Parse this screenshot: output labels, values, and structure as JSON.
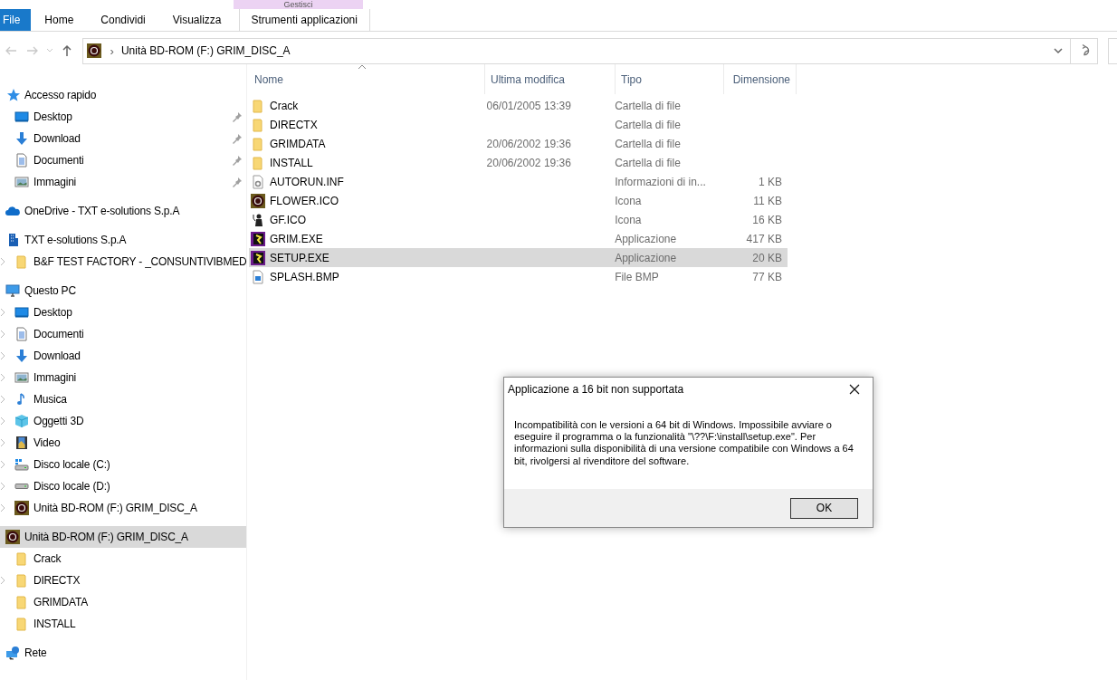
{
  "ribbon": {
    "context_header": "Gestisci",
    "tabs": [
      {
        "label": "File",
        "kind": "file"
      },
      {
        "label": "Home",
        "kind": "tab"
      },
      {
        "label": "Condividi",
        "kind": "tab"
      },
      {
        "label": "Visualizza",
        "kind": "tab"
      },
      {
        "label": "Strumenti applicazioni",
        "kind": "contextual"
      }
    ]
  },
  "address_bar": {
    "separator": "›",
    "path": "Unità BD-ROM (F:) GRIM_DISC_A"
  },
  "navigation": [
    {
      "label": "Accesso rapido",
      "kind": "star",
      "selected": false,
      "children": [
        {
          "label": "Desktop",
          "kind": "desktop",
          "pinned": true,
          "expandable": false
        },
        {
          "label": "Download",
          "kind": "download",
          "pinned": true,
          "expandable": false
        },
        {
          "label": "Documenti",
          "kind": "document",
          "pinned": true,
          "expandable": false
        },
        {
          "label": "Immagini",
          "kind": "image",
          "pinned": true,
          "expandable": false
        }
      ]
    },
    {
      "label": "OneDrive - TXT e-solutions S.p.A",
      "kind": "cloud",
      "selected": false
    },
    {
      "label": "TXT e-solutions S.p.A",
      "kind": "building",
      "selected": false,
      "children": [
        {
          "label": "B&F TEST FACTORY - _CONSUNTIVIBMED",
          "kind": "folder",
          "pinned": false,
          "expandable": true
        }
      ]
    },
    {
      "label": "Questo PC",
      "kind": "pc",
      "selected": false,
      "children": [
        {
          "label": "Desktop",
          "kind": "desktop",
          "pinned": false,
          "expandable": true
        },
        {
          "label": "Documenti",
          "kind": "document",
          "pinned": false,
          "expandable": true
        },
        {
          "label": "Download",
          "kind": "download",
          "pinned": false,
          "expandable": true
        },
        {
          "label": "Immagini",
          "kind": "image",
          "pinned": false,
          "expandable": true
        },
        {
          "label": "Musica",
          "kind": "music",
          "pinned": false,
          "expandable": true
        },
        {
          "label": "Oggetti 3D",
          "kind": "cube",
          "pinned": false,
          "expandable": true
        },
        {
          "label": "Video",
          "kind": "video",
          "pinned": false,
          "expandable": true
        },
        {
          "label": "Disco locale (C:)",
          "kind": "drive-c",
          "pinned": false,
          "expandable": true
        },
        {
          "label": "Disco locale (D:)",
          "kind": "drive",
          "pinned": false,
          "expandable": true
        },
        {
          "label": "Unità BD-ROM (F:) GRIM_DISC_A",
          "kind": "disc",
          "pinned": false,
          "expandable": true
        }
      ]
    },
    {
      "label": "Unità BD-ROM (F:) GRIM_DISC_A",
      "kind": "disc",
      "selected": true,
      "children": [
        {
          "label": "Crack",
          "kind": "folder",
          "pinned": false,
          "expandable": false
        },
        {
          "label": "DIRECTX",
          "kind": "folder",
          "pinned": false,
          "expandable": true
        },
        {
          "label": "GRIMDATA",
          "kind": "folder",
          "pinned": false,
          "expandable": false
        },
        {
          "label": "INSTALL",
          "kind": "folder",
          "pinned": false,
          "expandable": false
        }
      ]
    },
    {
      "label": "Rete",
      "kind": "network",
      "selected": false
    }
  ],
  "file_list": {
    "columns": [
      "Nome",
      "Ultima modifica",
      "Tipo",
      "Dimensione"
    ],
    "rows": [
      {
        "name": "Crack",
        "modified": "06/01/2005 13:39",
        "type": "Cartella di file",
        "kind": "folder",
        "selected": false
      },
      {
        "name": "DIRECTX",
        "type": "Cartella di file",
        "kind": "folder",
        "selected": false
      },
      {
        "name": "GRIMDATA",
        "modified": "20/06/2002 19:36",
        "type": "Cartella di file",
        "kind": "folder",
        "selected": false
      },
      {
        "name": "INSTALL",
        "modified": "20/06/2002 19:36",
        "type": "Cartella di file",
        "kind": "folder",
        "selected": false
      },
      {
        "name": "AUTORUN.INF",
        "type": "Informazioni di in...",
        "size": "1 KB",
        "kind": "settings-file",
        "selected": false
      },
      {
        "name": "FLOWER.ICO",
        "type": "Icona",
        "size": "11 KB",
        "kind": "disc",
        "selected": false
      },
      {
        "name": "GF.ICO",
        "type": "Icona",
        "size": "16 KB",
        "kind": "figure",
        "selected": false
      },
      {
        "name": "GRIM.EXE",
        "type": "Applicazione",
        "size": "417 KB",
        "kind": "app",
        "selected": false
      },
      {
        "name": "SETUP.EXE",
        "type": "Applicazione",
        "size": "20 KB",
        "kind": "app",
        "selected": true
      },
      {
        "name": "SPLASH.BMP",
        "type": "File BMP",
        "size": "77 KB",
        "kind": "bitmap",
        "selected": false
      }
    ]
  },
  "dialog": {
    "title": "Applicazione a 16 bit non supportata",
    "message": "Incompatibilità con le versioni a 64 bit di Windows. Impossibile avviare o eseguire il programma o la funzionalità \"\\??\\F:\\install\\setup.exe\". Per informazioni sulla disponibilità di una versione compatibile con Windows a 64 bit, rivolgersi al rivenditore del software.",
    "buttons": [
      "OK"
    ]
  }
}
